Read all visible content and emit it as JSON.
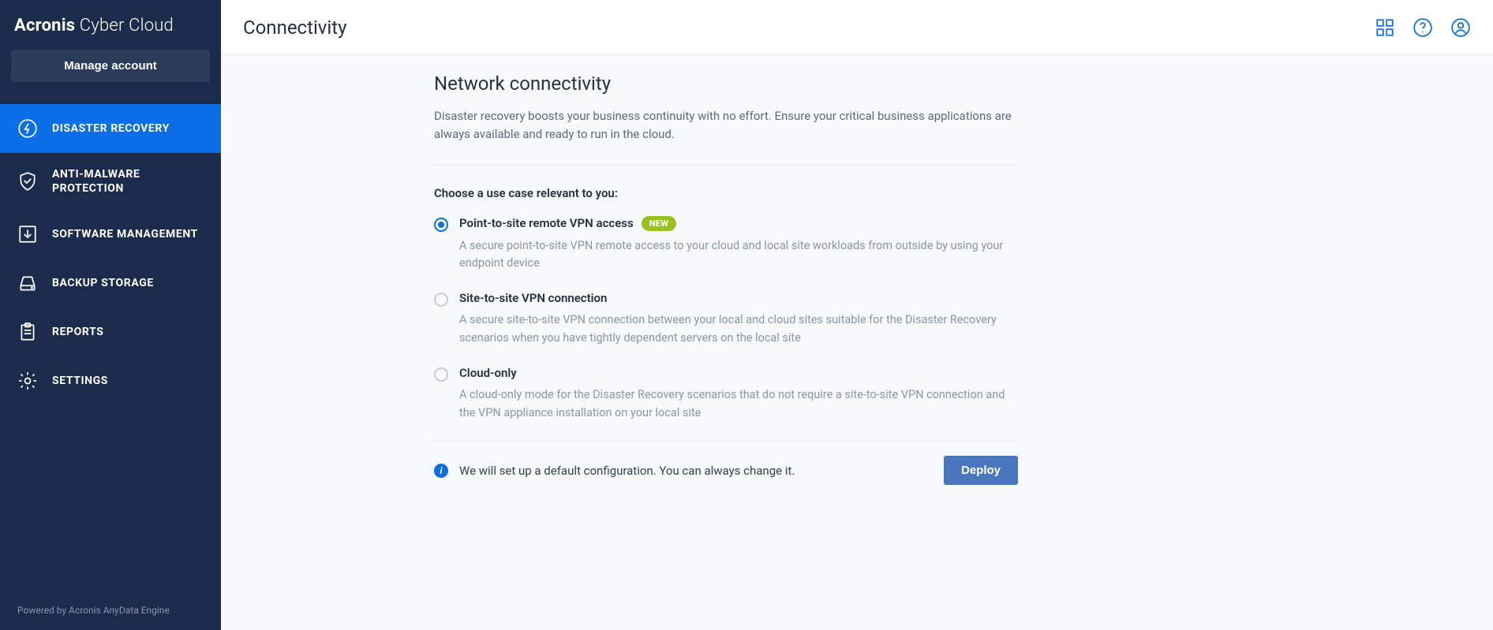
{
  "brand": {
    "bold": "Acronis",
    "light": " Cyber Cloud"
  },
  "sidebar": {
    "manage_label": "Manage account",
    "items": [
      {
        "label": "DISASTER RECOVERY"
      },
      {
        "label": "ANTI-MALWARE PROTECTION"
      },
      {
        "label": "SOFTWARE MANAGEMENT"
      },
      {
        "label": "BACKUP STORAGE"
      },
      {
        "label": "REPORTS"
      },
      {
        "label": "SETTINGS"
      }
    ],
    "footer": "Powered by Acronis AnyData Engine"
  },
  "page": {
    "title": "Connectivity",
    "heading": "Network connectivity",
    "description": "Disaster recovery boosts your business continuity with no effort. Ensure your critical business applications are always available and ready to run in the cloud.",
    "choose_label": "Choose a use case relevant to you:",
    "options": [
      {
        "title": "Point-to-site remote VPN access",
        "badge": "NEW",
        "desc": "A secure point-to-site VPN remote access to your cloud and local site workloads from outside by using your endpoint device"
      },
      {
        "title": "Site-to-site VPN connection",
        "desc": "A secure site-to-site VPN connection between your local and cloud sites suitable for the Disaster Recovery scenarios when you have tightly dependent servers on the local site"
      },
      {
        "title": "Cloud-only",
        "desc": "A cloud-only mode for the Disaster Recovery scenarios that do not require a site-to-site VPN connection and the VPN appliance installation on your local site"
      }
    ],
    "footer_note": "We will set up a default configuration. You can always change it.",
    "deploy_label": "Deploy"
  }
}
